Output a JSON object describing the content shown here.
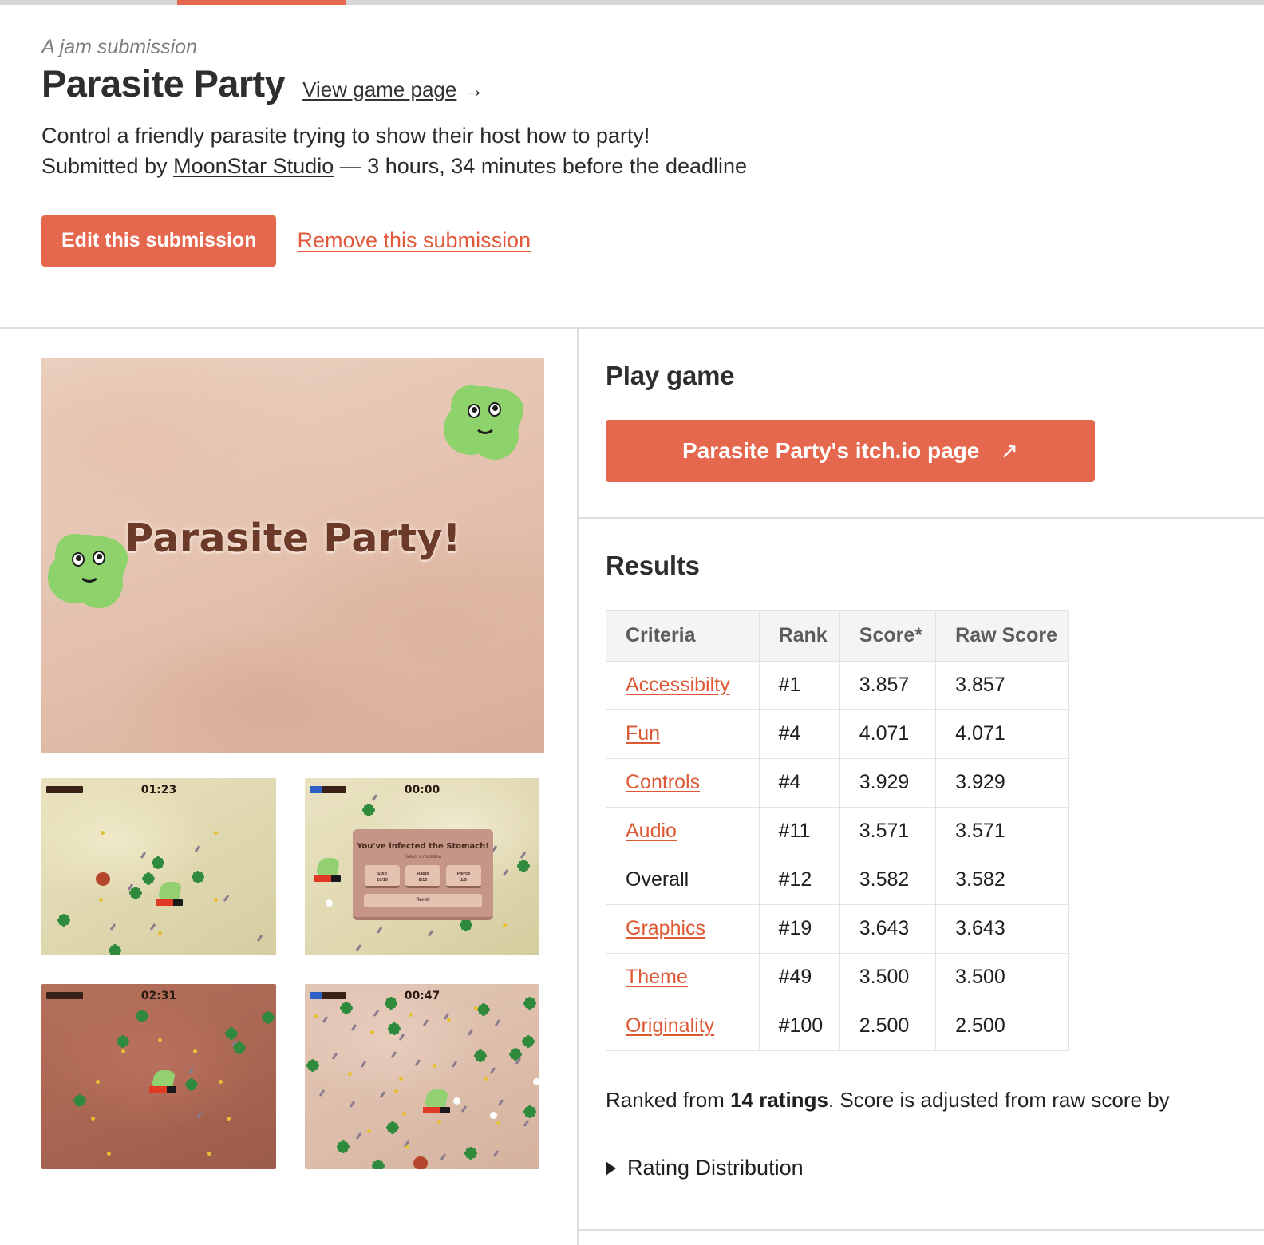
{
  "top_nav": {
    "active_tab_accent": "#e5684e"
  },
  "header": {
    "eyebrow": "A jam submission",
    "title": "Parasite Party",
    "view_game_page_label": "View game page",
    "view_game_page_arrow": "→",
    "tagline": "Control a friendly parasite trying to show their host how to party!",
    "submitted_prefix": "Submitted by ",
    "author": "MoonStar Studio",
    "submitted_suffix": " — 3 hours, 34 minutes before the deadline",
    "edit_button_label": "Edit this submission",
    "remove_link_label": "Remove this submission"
  },
  "media": {
    "hero": {
      "title_text": "Parasite Party!",
      "alt": "Parasite Party title screen"
    },
    "thumbnails": [
      {
        "name": "gameplay-timer-0123",
        "timer": "01:23",
        "has_blue_bar": false
      },
      {
        "name": "stomach-infected-upgrade-dialog",
        "timer": "00:00",
        "has_blue_bar": true,
        "dialog_title": "You've infected the Stomach!",
        "dialog_subtitle": "Select a mutation",
        "upgrades": [
          "Split\n10/10",
          "Rapid\n8/10",
          "Pierce\n1/5"
        ],
        "reroll_label": "Reroll"
      },
      {
        "name": "gameplay-timer-0231",
        "timer": "02:31",
        "has_blue_bar": false
      },
      {
        "name": "gameplay-timer-0047",
        "timer": "00:47",
        "has_blue_bar": true
      }
    ]
  },
  "play_game": {
    "heading": "Play game",
    "button_label": "Parasite Party's itch.io page",
    "external_icon": "↗"
  },
  "results": {
    "heading": "Results",
    "columns": [
      "Criteria",
      "Rank",
      "Score*",
      "Raw Score"
    ],
    "rows": [
      {
        "criteria": "Accessibilty",
        "linked": true,
        "rank": "#1",
        "score": "3.857",
        "raw_score": "3.857"
      },
      {
        "criteria": "Fun",
        "linked": true,
        "rank": "#4",
        "score": "4.071",
        "raw_score": "4.071"
      },
      {
        "criteria": "Controls",
        "linked": true,
        "rank": "#4",
        "score": "3.929",
        "raw_score": "3.929"
      },
      {
        "criteria": "Audio",
        "linked": true,
        "rank": "#11",
        "score": "3.571",
        "raw_score": "3.571"
      },
      {
        "criteria": "Overall",
        "linked": false,
        "rank": "#12",
        "score": "3.582",
        "raw_score": "3.582"
      },
      {
        "criteria": "Graphics",
        "linked": true,
        "rank": "#19",
        "score": "3.643",
        "raw_score": "3.643"
      },
      {
        "criteria": "Theme",
        "linked": true,
        "rank": "#49",
        "score": "3.500",
        "raw_score": "3.500"
      },
      {
        "criteria": "Originality",
        "linked": true,
        "rank": "#100",
        "score": "2.500",
        "raw_score": "2.500"
      }
    ],
    "ranked_note_prefix": "Ranked from ",
    "ranked_note_count": "14 ratings",
    "ranked_note_suffix": ". Score is adjusted from raw score by",
    "rating_distribution_label": "Rating Distribution"
  },
  "colors": {
    "accent_orange": "#e5684e",
    "link_orange": "#dd5834",
    "divider_gray": "#dcdcdc",
    "table_header_bg": "#f4f4f4"
  }
}
